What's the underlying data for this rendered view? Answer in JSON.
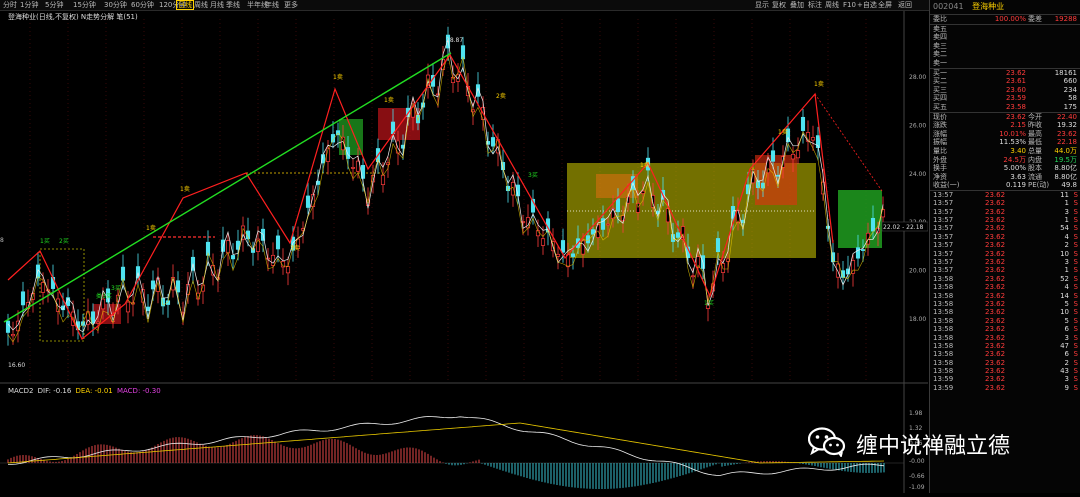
{
  "toolbar": {
    "left_items": [
      "分时",
      "1分钟",
      "5分钟",
      "15分钟",
      "30分钟",
      "60分钟",
      "120分钟",
      "日线",
      "周线",
      "月线",
      "季线",
      "半年线",
      "年线",
      "更多"
    ],
    "active_item": "日线",
    "right_items": [
      "显示",
      "复权",
      "叠加",
      "标注",
      "周线",
      "F10",
      "+自选",
      "全屏",
      "返回"
    ]
  },
  "chart": {
    "title": "登海种业(日线,不复权)  N走势分解  笔(51)",
    "peak_label": "28.87",
    "low_label": "16.60",
    "price_axis": [
      "28.00",
      "26.00",
      "24.00",
      "22.00",
      "20.00",
      "18.00"
    ],
    "current_price_tag": "22.02 - 22.18",
    "left_axis_mark": "8",
    "annotations": [
      "1卖",
      "2卖",
      "3卖",
      "1买",
      "2买",
      "3买",
      "类3买",
      "买",
      "卖"
    ],
    "macd_label_name": "MACD2",
    "macd_dif": "DIF: -0.16",
    "macd_dea": "DEA: -0.01",
    "macd_value": "MACD: -0.30",
    "macd_axis": [
      "1.98",
      "1.32",
      "0.66",
      "-0.00",
      "-0.66",
      "-1.09"
    ]
  },
  "quote": {
    "code": "002041",
    "name": "登海种业",
    "ratio_label": "委比",
    "ratio_value": "100.00%",
    "diff_label": "委差",
    "diff_value": "19288",
    "sells": [
      {
        "label": "卖五",
        "price": "",
        "vol": ""
      },
      {
        "label": "卖四",
        "price": "",
        "vol": ""
      },
      {
        "label": "卖三",
        "price": "",
        "vol": ""
      },
      {
        "label": "卖二",
        "price": "",
        "vol": ""
      },
      {
        "label": "卖一",
        "price": "",
        "vol": ""
      }
    ],
    "buys": [
      {
        "label": "买一",
        "price": "23.62",
        "vol": "18161"
      },
      {
        "label": "买二",
        "price": "23.61",
        "vol": "660"
      },
      {
        "label": "买三",
        "price": "23.60",
        "vol": "234"
      },
      {
        "label": "买四",
        "price": "23.59",
        "vol": "58"
      },
      {
        "label": "买五",
        "price": "23.58",
        "vol": "175"
      }
    ],
    "stats": [
      {
        "l1": "现价",
        "v1": "23.62",
        "c1": "red",
        "l2": "今开",
        "v2": "22.40",
        "c2": "red"
      },
      {
        "l1": "涨跌",
        "v1": "2.15",
        "c1": "red",
        "l2": "昨收",
        "v2": "19.32",
        "c2": "white"
      },
      {
        "l1": "涨幅",
        "v1": "10.01%",
        "c1": "red",
        "l2": "最高",
        "v2": "23.62",
        "c2": "red"
      },
      {
        "l1": "振幅",
        "v1": "11.53%",
        "c1": "white",
        "l2": "最低",
        "v2": "22.18",
        "c2": "red"
      },
      {
        "l1": "量比",
        "v1": "3.40",
        "c1": "yellow",
        "l2": "总量",
        "v2": "44.0万",
        "c2": "yellow"
      },
      {
        "l1": "外盘",
        "v1": "24.5万",
        "c1": "red",
        "l2": "内盘",
        "v2": "19.5万",
        "c2": "green"
      },
      {
        "l1": "换手",
        "v1": "5.00%",
        "c1": "white",
        "l2": "股本",
        "v2": "8.80亿",
        "c2": "white"
      },
      {
        "l1": "净资",
        "v1": "3.63",
        "c1": "white",
        "l2": "流通",
        "v2": "8.80亿",
        "c2": "white"
      },
      {
        "l1": "收益(一)",
        "v1": "0.119",
        "c1": "white",
        "l2": "PE(动)",
        "v2": "49.8",
        "c2": "white"
      }
    ],
    "ticks": [
      {
        "t": "13:57",
        "p": "23.62",
        "v": "11",
        "s": "S"
      },
      {
        "t": "13:57",
        "p": "23.62",
        "v": "1",
        "s": "S"
      },
      {
        "t": "13:57",
        "p": "23.62",
        "v": "3",
        "s": "S"
      },
      {
        "t": "13:57",
        "p": "23.62",
        "v": "1",
        "s": "S"
      },
      {
        "t": "13:57",
        "p": "23.62",
        "v": "54",
        "s": "S"
      },
      {
        "t": "13:57",
        "p": "23.62",
        "v": "4",
        "s": "S"
      },
      {
        "t": "13:57",
        "p": "23.62",
        "v": "2",
        "s": "S"
      },
      {
        "t": "13:57",
        "p": "23.62",
        "v": "10",
        "s": "S"
      },
      {
        "t": "13:57",
        "p": "23.62",
        "v": "3",
        "s": "S"
      },
      {
        "t": "13:57",
        "p": "23.62",
        "v": "1",
        "s": "S"
      },
      {
        "t": "13:58",
        "p": "23.62",
        "v": "52",
        "s": "S"
      },
      {
        "t": "13:58",
        "p": "23.62",
        "v": "4",
        "s": "S"
      },
      {
        "t": "13:58",
        "p": "23.62",
        "v": "14",
        "s": "S"
      },
      {
        "t": "13:58",
        "p": "23.62",
        "v": "5",
        "s": "S"
      },
      {
        "t": "13:58",
        "p": "23.62",
        "v": "10",
        "s": "S"
      },
      {
        "t": "13:58",
        "p": "23.62",
        "v": "5",
        "s": "S"
      },
      {
        "t": "13:58",
        "p": "23.62",
        "v": "6",
        "s": "S"
      },
      {
        "t": "13:58",
        "p": "23.62",
        "v": "3",
        "s": "S"
      },
      {
        "t": "13:58",
        "p": "23.62",
        "v": "47",
        "s": "S"
      },
      {
        "t": "13:58",
        "p": "23.62",
        "v": "6",
        "s": "S"
      },
      {
        "t": "13:58",
        "p": "23.62",
        "v": "2",
        "s": "S"
      },
      {
        "t": "13:58",
        "p": "23.62",
        "v": "43",
        "s": "S"
      },
      {
        "t": "13:59",
        "p": "23.62",
        "v": "3",
        "s": "S"
      },
      {
        "t": "13:59",
        "p": "23.62",
        "v": "9",
        "s": "S"
      }
    ]
  },
  "watermark": {
    "text": "缠中说禅融立德"
  },
  "colors": {
    "up": "#ff3b3b",
    "down": "#4fe3f0",
    "zone_yellow": "#b9b400",
    "zone_green": "#22a822",
    "trend_green": "#22dd22"
  }
}
